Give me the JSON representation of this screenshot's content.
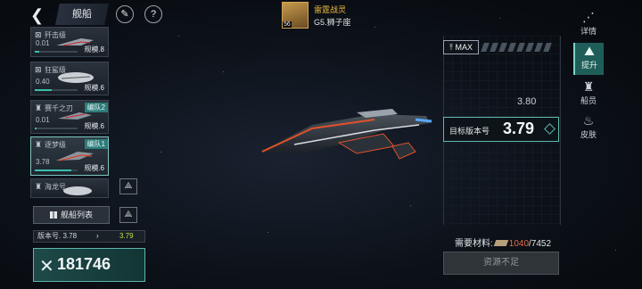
{
  "header": {
    "back_icon": "back-arrow-icon",
    "title": "舰船",
    "feather_icon": "quill-icon",
    "help_icon": "question-icon",
    "help_glyph": "?"
  },
  "commander": {
    "name": "雷霆战灵",
    "grade": "G5.狮子座",
    "level": "56"
  },
  "ships": [
    {
      "name": "歼击级",
      "version": "0.01",
      "scale": "规模.8",
      "badge": "",
      "progress": 0.1,
      "selected": false
    },
    {
      "name": "狂鲨级",
      "version": "0.40",
      "scale": "规模.6",
      "badge": "",
      "progress": 0.4,
      "selected": false
    },
    {
      "name": "赛千之刃",
      "version": "0.01",
      "scale": "规模.6",
      "badge": "编队2",
      "progress": 0.05,
      "selected": false
    },
    {
      "name": "逐梦级",
      "version": "3.78",
      "scale": "规模.6",
      "badge": "编队1",
      "progress": 0.85,
      "selected": true
    },
    {
      "name": "海龙号",
      "version": "",
      "scale": "",
      "badge": "",
      "progress": 0,
      "selected": false
    }
  ],
  "ship_list_button": "舰船列表",
  "version_row": {
    "label": "版本号. 3.78",
    "arrow": "›",
    "next": "3.79"
  },
  "power": {
    "icon": "crossed-swords-icon",
    "glyph": "✕",
    "value": "181746"
  },
  "upgrade_panel": {
    "max_label": "MAX",
    "current_version": "3.80",
    "target_label": "目标版本号",
    "target_value": "3.79",
    "need_label": "需要材料:",
    "have": "1040",
    "need": "/7452",
    "action": "资源不足"
  },
  "right_nav": [
    {
      "label": "详情",
      "icon": "grid-icon",
      "glyph": "⋰",
      "active": false
    },
    {
      "label": "提升",
      "icon": "upgrade-icon",
      "glyph": "⛰",
      "active": true
    },
    {
      "label": "船员",
      "icon": "crew-icon",
      "glyph": "♜",
      "active": false
    },
    {
      "label": "皮肤",
      "icon": "skin-icon",
      "glyph": "♨",
      "active": false
    }
  ],
  "colors": {
    "accent": "#5fb9ae",
    "commander_name": "#f0b93b",
    "next_version": "#b8e04b",
    "insufficient_amount": "#e36d4a"
  }
}
